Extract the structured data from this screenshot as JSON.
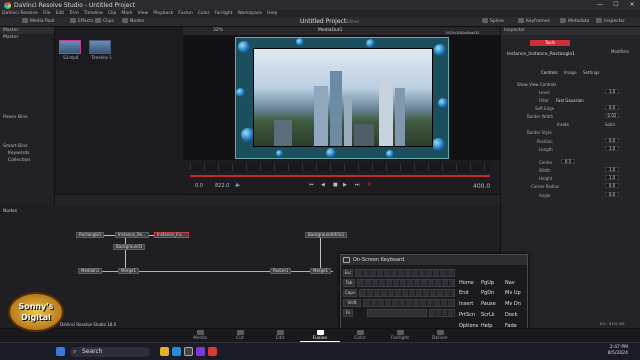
{
  "window": {
    "title": "DaVinci Resolve Studio - Untitled Project",
    "controls": [
      "—",
      "☐",
      "✕"
    ]
  },
  "menu": [
    "DaVinci Resolve",
    "File",
    "Edit",
    "Trim",
    "Timeline",
    "Clip",
    "Mark",
    "View",
    "Playback",
    "Fusion",
    "Color",
    "Fairlight",
    "Workspace",
    "Help"
  ],
  "toolbar": {
    "left": [
      "Media Pool",
      "Effects",
      "Clips",
      "Nodes"
    ],
    "project_title": "Untitled Project",
    "project_status": "Edited",
    "right": [
      "Spline",
      "Keyframes",
      "Metadata",
      "Inspector"
    ]
  },
  "media_pool": {
    "header": "Master",
    "bins": [
      "Master"
    ],
    "power_bins": "Power Bins",
    "smart_bins": "Smart Bins",
    "smart_items": [
      "Keywords",
      "Collection"
    ],
    "thumbs": [
      "53.mp4",
      "Timeline 1"
    ]
  },
  "viewer": {
    "zoom": "32%",
    "name": "MediaOut1",
    "resolution": "1920x1080xfloat32",
    "start": "0.0",
    "current": "822.0",
    "end": "400.0"
  },
  "nodes": {
    "label": "Nodes",
    "items": [
      "Rectangle1",
      "Instance_Re...",
      "Instance_Inc...",
      "Background1",
      "MediaIn1",
      "Merge1",
      "Resize1",
      "Merge1",
      "BackgroundUtilis1"
    ]
  },
  "inspector": {
    "title": "Inspector",
    "tabs": [
      "Tools",
      "Modifiers"
    ],
    "node_name": "Instance_Instance_Rectangle1",
    "subtabs": [
      "Controls",
      "Image",
      "Settings"
    ],
    "show_view_controls": "Show View Controls",
    "rows": [
      {
        "label": "Level",
        "value": "1.0"
      },
      {
        "label": "Filter",
        "value": "Fast Gaussian"
      },
      {
        "label": "Soft Edge",
        "value": "0.0"
      },
      {
        "label": "Border Width",
        "value": "0.02"
      },
      {
        "label": "Border Style",
        "value": ""
      },
      {
        "label": "Position",
        "value": "0.0"
      },
      {
        "label": "Length",
        "value": "1.0"
      },
      {
        "label": "Center",
        "value": "0.5"
      },
      {
        "label": "Width",
        "value": "1.0"
      },
      {
        "label": "Height",
        "value": "1.0"
      },
      {
        "label": "Corner Radius",
        "value": "0.0"
      },
      {
        "label": "Angle",
        "value": "0.0"
      }
    ],
    "style_options": [
      "Inside",
      "Solid"
    ]
  },
  "keyboard": {
    "title": "On-Screen Keyboard",
    "nav_keys": [
      [
        "Home",
        "PgUp",
        "Nav"
      ],
      [
        "End",
        "PgDn",
        "Mv Up"
      ],
      [
        "Insert",
        "Pause",
        "Mv Dn"
      ],
      [
        "PrtScn",
        "ScrLk",
        "Dock"
      ],
      [
        "Options",
        "Help",
        "Fade"
      ]
    ],
    "left_keys": [
      "Esc",
      "Tab",
      "Caps",
      "Shift",
      "Fn"
    ]
  },
  "pages": [
    "Media",
    "Cut",
    "Edit",
    "Fusion",
    "Color",
    "Fairlight",
    "Deliver"
  ],
  "active_page": "Fusion",
  "status": {
    "left": "DaVinci Resolve Studio 18.6",
    "right": "8% - 8191 MB"
  },
  "taskbar": {
    "search": "Search",
    "time": "2:47 PM",
    "date": "8/5/2024"
  },
  "watermark": {
    "line1": "Sonny's",
    "line2": "Digital"
  },
  "colors": {
    "accent": "#c8303a",
    "fusion_active": "#ffffff",
    "wire_yellow": "#c8c020"
  }
}
